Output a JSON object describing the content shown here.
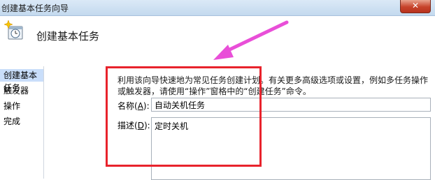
{
  "window": {
    "title": "创建基本任务向导",
    "close_glyph": "✕"
  },
  "header": {
    "title": "创建基本任务",
    "icon": "task-clock-icon"
  },
  "sidebar": {
    "items": [
      {
        "label": "创建基本任务",
        "active": true
      },
      {
        "label": "触发器",
        "active": false
      },
      {
        "label": "操作",
        "active": false
      },
      {
        "label": "完成",
        "active": false
      }
    ]
  },
  "main": {
    "description": "利用该向导快速地为常见任务创建计划。有关更多高级选项或设置，例如多任务操作或触发器，请使用“操作”窗格中的“创建任务”命令。",
    "name_field": {
      "label": "名称",
      "mnemonic": "A",
      "value": "自动关机任务"
    },
    "desc_field": {
      "label": "描述",
      "mnemonic": "D",
      "value": "定时关机"
    }
  },
  "annotation": {
    "highlight_color": "#e8232c",
    "arrow_color": "#e94fd8"
  }
}
